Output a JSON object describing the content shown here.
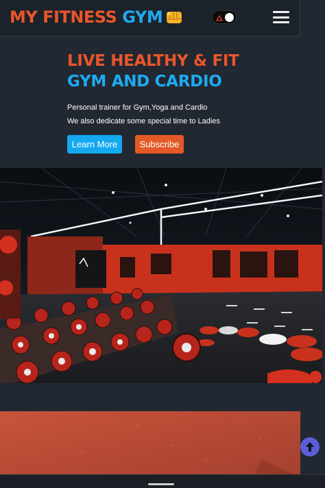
{
  "navbar": {
    "brand_part1": "MY FITNESS",
    "brand_part2": "GYM",
    "brand_icon": "fist-bump-emoji",
    "theme_toggle_icon": "theme-toggle-switch",
    "menu_icon": "hamburger-menu-icon"
  },
  "hero": {
    "title_line1": "LIVE HEALTHY & FIT",
    "title_line2": "GYM AND CARDIO",
    "description_line1": "Personal trainer for Gym,Yoga and Cardio",
    "description_line2": "We also dedicate some special time to Ladies",
    "learn_more_label": "Learn More",
    "subscribe_label": "Subscribe"
  },
  "images": {
    "gym_image": "gym-interior-photo",
    "track_image": "running-track-photo"
  },
  "scroll_top_icon": "arrow-up-icon",
  "colors": {
    "background": "#222831",
    "navbar": "#1c222a",
    "accent_orange": "#e8562a",
    "accent_blue": "#1eaaf1",
    "scroll_button": "#5a5fd8"
  }
}
